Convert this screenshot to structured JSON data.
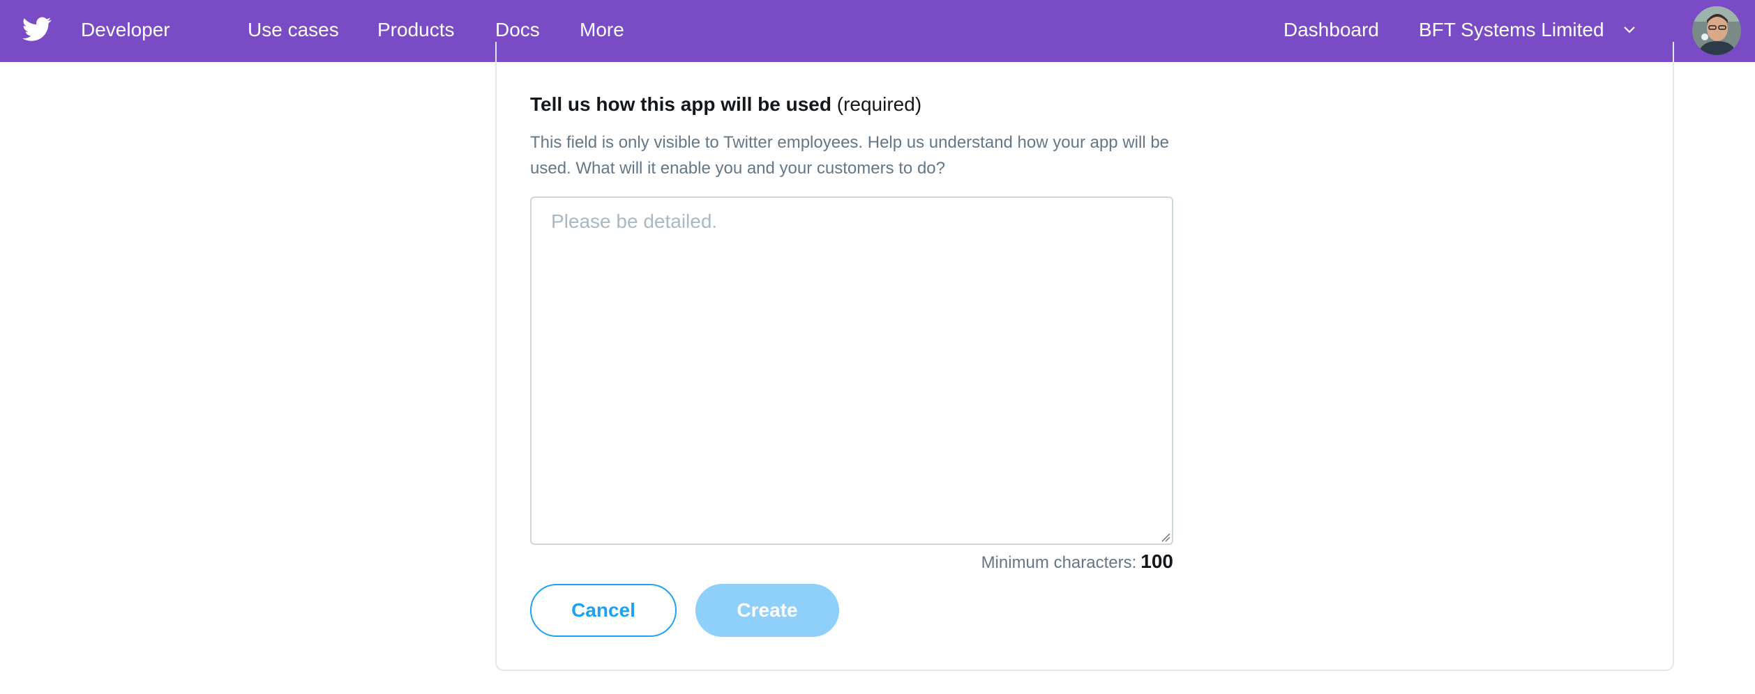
{
  "nav": {
    "logo_icon": "twitter-bird-icon",
    "brand": "Developer",
    "links": [
      "Use cases",
      "Products",
      "Docs",
      "More"
    ],
    "dashboard": "Dashboard",
    "account": "BFT Systems Limited",
    "account_icon": "chevron-down-icon",
    "bg_color": "#794bc4"
  },
  "form": {
    "heading_bold": "Tell us how this app will be used",
    "heading_suffix": "(required)",
    "help_text": "This field is only visible to Twitter employees. Help us understand how your app will be used. What will it enable you and your customers to do?",
    "textarea_value": "",
    "textarea_placeholder": "Please be detailed.",
    "min_chars_label": "Minimum characters:",
    "min_chars_value": "100",
    "cancel_label": "Cancel",
    "create_label": "Create",
    "accent_color": "#1da1f2",
    "disabled_color": "#8ed0f9"
  }
}
